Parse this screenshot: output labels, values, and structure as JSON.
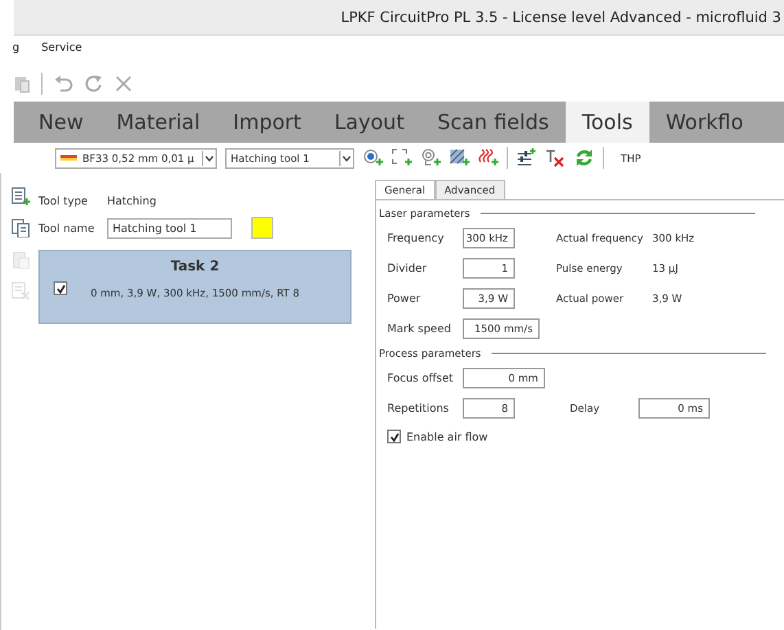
{
  "window": {
    "title": "LPKF CircuitPro PL 3.5 - License level Advanced - microfluid 3"
  },
  "menu": [
    {
      "label": "g"
    },
    {
      "label": "Service"
    }
  ],
  "ribbon_tabs": [
    {
      "label": "New",
      "selected": false
    },
    {
      "label": "Material",
      "selected": false
    },
    {
      "label": "Import",
      "selected": false
    },
    {
      "label": "Layout",
      "selected": false
    },
    {
      "label": "Scan fields",
      "selected": false
    },
    {
      "label": "Tools",
      "selected": true
    },
    {
      "label": "Workflo",
      "selected": false
    }
  ],
  "tool_bar": {
    "material": "BF33 0,52 mm 0,01 µ",
    "tool": "Hatching tool 1",
    "label": "THP"
  },
  "tool": {
    "type_label": "Tool type",
    "type_value": "Hatching",
    "name_label": "Tool name",
    "name_value": "Hatching tool 1",
    "color": "#ffff00"
  },
  "left_actions": [
    {
      "disabled": false
    },
    {
      "disabled": false
    },
    {
      "disabled": true
    },
    {
      "disabled": true
    }
  ],
  "task": {
    "title": "Task 2",
    "checked": true,
    "summary": "0 mm, 3,9 W, 300 kHz, 1500 mm/s, RT 8"
  },
  "panel_tabs": [
    {
      "label": "General",
      "selected": true
    },
    {
      "label": "Advanced",
      "selected": false
    }
  ],
  "groups": [
    {
      "title": "Laser parameters",
      "rows": [
        {
          "label": "Frequency",
          "value": "300 kHz",
          "side": {
            "kind": "readout",
            "label": "Actual frequency",
            "value": "300 kHz"
          }
        },
        {
          "label": "Divider",
          "value": "1",
          "side": {
            "kind": "readout",
            "label": "Pulse energy",
            "value": "13 µJ"
          }
        },
        {
          "label": "Power",
          "value": "3,9 W",
          "side": {
            "kind": "readout",
            "label": "Actual power",
            "value": "3,9 W"
          }
        },
        {
          "label": "Mark speed",
          "value": "1500 mm/s"
        }
      ]
    },
    {
      "title": "Process parameters",
      "rows": [
        {
          "label": "Focus offset",
          "value": "0 mm"
        },
        {
          "label": "Repetitions",
          "value": "8",
          "side": {
            "kind": "field",
            "label": "Delay",
            "value": "0 ms"
          }
        }
      ]
    }
  ],
  "air_flow": {
    "label": "Enable air flow",
    "checked": true
  }
}
